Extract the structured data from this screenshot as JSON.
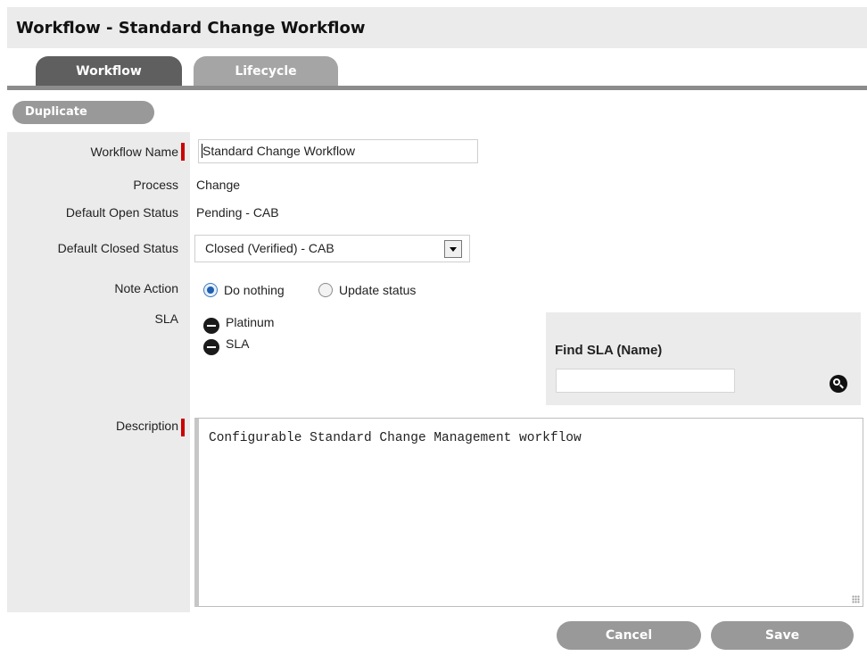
{
  "page": {
    "title": "Workflow - Standard Change Workflow"
  },
  "tabs": [
    {
      "label": "Workflow",
      "active": true
    },
    {
      "label": "Lifecycle",
      "active": false
    }
  ],
  "toolbar": {
    "duplicate_label": "Duplicate"
  },
  "form": {
    "workflow_name": {
      "label": "Workflow Name",
      "value": "Standard Change Workflow",
      "required": true
    },
    "process": {
      "label": "Process",
      "value": "Change"
    },
    "default_open_status": {
      "label": "Default Open Status",
      "value": "Pending - CAB"
    },
    "default_closed_status": {
      "label": "Default Closed Status",
      "selected": "Closed (Verified) - CAB"
    },
    "note_action": {
      "label": "Note Action",
      "options": [
        {
          "label": "Do nothing",
          "checked": true
        },
        {
          "label": "Update status",
          "checked": false
        }
      ]
    },
    "sla": {
      "label": "SLA",
      "items": [
        "Platinum",
        "SLA"
      ],
      "find_title": "Find SLA (Name)",
      "find_value": ""
    },
    "description": {
      "label": "Description",
      "value": "Configurable Standard Change Management workflow",
      "required": true
    }
  },
  "actions": {
    "cancel_label": "Cancel",
    "save_label": "Save"
  },
  "colors": {
    "required_marker": "#cc0000",
    "tab_active": "#5f5f5f",
    "tab_inactive": "#a5a5a5",
    "button": "#999999",
    "panel_bg": "#ebebeb"
  }
}
